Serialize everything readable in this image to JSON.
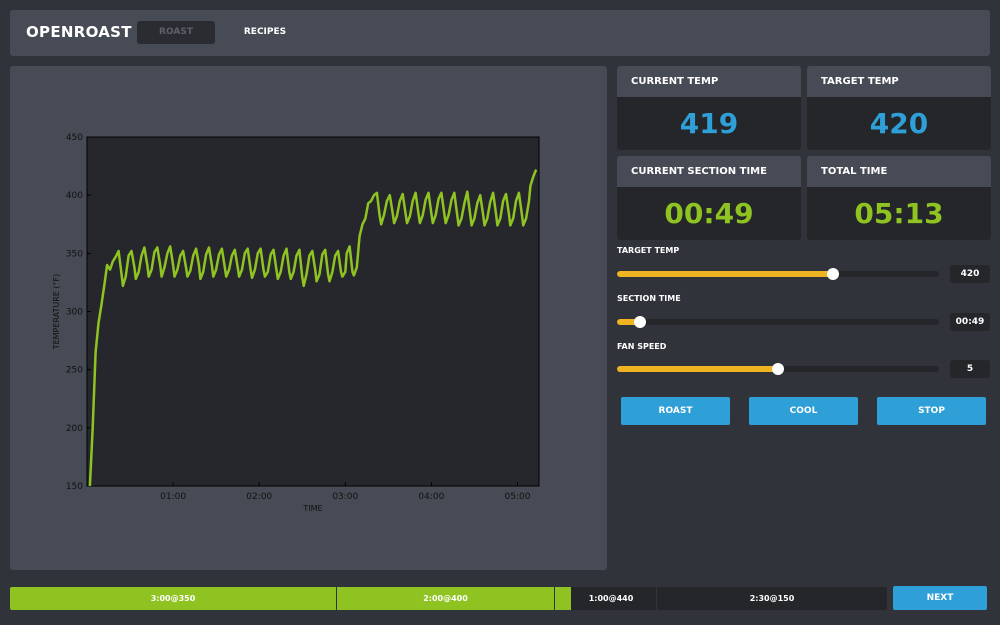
{
  "header": {
    "brand": "OPENROAST",
    "tabs": [
      {
        "label": "ROAST",
        "active": true
      },
      {
        "label": "RECIPES",
        "active": false
      }
    ]
  },
  "stats": {
    "current_temp": {
      "label": "CURRENT TEMP",
      "value": "419"
    },
    "target_temp": {
      "label": "TARGET TEMP",
      "value": "420"
    },
    "current_section_time": {
      "label": "CURRENT SECTION TIME",
      "value": "00:49"
    },
    "total_time": {
      "label": "TOTAL TIME",
      "value": "05:13"
    }
  },
  "controls": {
    "target_temp": {
      "label": "TARGET TEMP",
      "value": "420",
      "level": 0.67
    },
    "section_time": {
      "label": "SECTION TIME",
      "value": "00:49",
      "level": 0.07
    },
    "fan_speed": {
      "label": "FAN SPEED",
      "value": "5",
      "level": 0.5
    }
  },
  "buttons": {
    "roast": "ROAST",
    "cool": "COOL",
    "stop": "STOP",
    "next": "NEXT"
  },
  "timeline": {
    "segments": [
      {
        "label": "3:00@350"
      },
      {
        "label": "2:00@400"
      },
      {
        "label": "1:00@440"
      },
      {
        "label": "2:30@150"
      }
    ],
    "elapsed_fraction": 0.64
  },
  "colors": {
    "accent_blue": "#2f9fd8",
    "accent_green": "#8fc321",
    "slider_orange": "#f0b322",
    "panel": "#474b55",
    "dark": "#24262a"
  },
  "chart_data": {
    "type": "line",
    "xlabel": "TIME",
    "ylabel": "TEMPERATURE (°F)",
    "xlim": [
      0,
      315
    ],
    "ylim": [
      150,
      450
    ],
    "x_ticks": [
      {
        "value": 60,
        "label": "01:00"
      },
      {
        "value": 120,
        "label": "02:00"
      },
      {
        "value": 180,
        "label": "03:00"
      },
      {
        "value": 240,
        "label": "04:00"
      },
      {
        "value": 300,
        "label": "05:00"
      }
    ],
    "y_ticks": [
      150,
      200,
      250,
      300,
      350,
      400,
      450
    ],
    "series": [
      {
        "color": "#8fc321",
        "points": [
          [
            2,
            150
          ],
          [
            4,
            200
          ],
          [
            6,
            265
          ],
          [
            8,
            290
          ],
          [
            10,
            305
          ],
          [
            12,
            322
          ],
          [
            14,
            340
          ],
          [
            16,
            336
          ],
          [
            18,
            343
          ],
          [
            20,
            347
          ],
          [
            22,
            352
          ],
          [
            24,
            333
          ],
          [
            25,
            322
          ],
          [
            27,
            330
          ],
          [
            29,
            348
          ],
          [
            31,
            352
          ],
          [
            33,
            338
          ],
          [
            34,
            328
          ],
          [
            36,
            334
          ],
          [
            38,
            348
          ],
          [
            40,
            355
          ],
          [
            42,
            340
          ],
          [
            43,
            330
          ],
          [
            45,
            336
          ],
          [
            47,
            351
          ],
          [
            49,
            355
          ],
          [
            51,
            340
          ],
          [
            52,
            330
          ],
          [
            54,
            338
          ],
          [
            56,
            350
          ],
          [
            58,
            356
          ],
          [
            60,
            340
          ],
          [
            61,
            330
          ],
          [
            63,
            336
          ],
          [
            65,
            348
          ],
          [
            67,
            352
          ],
          [
            69,
            338
          ],
          [
            70,
            330
          ],
          [
            72,
            335
          ],
          [
            74,
            348
          ],
          [
            76,
            354
          ],
          [
            78,
            340
          ],
          [
            79,
            328
          ],
          [
            81,
            334
          ],
          [
            83,
            349
          ],
          [
            85,
            355
          ],
          [
            87,
            340
          ],
          [
            88,
            330
          ],
          [
            90,
            336
          ],
          [
            92,
            349
          ],
          [
            94,
            354
          ],
          [
            96,
            338
          ],
          [
            97,
            330
          ],
          [
            99,
            336
          ],
          [
            101,
            348
          ],
          [
            103,
            353
          ],
          [
            105,
            338
          ],
          [
            106,
            330
          ],
          [
            108,
            336
          ],
          [
            110,
            350
          ],
          [
            112,
            354
          ],
          [
            114,
            336
          ],
          [
            115,
            329
          ],
          [
            117,
            336
          ],
          [
            119,
            350
          ],
          [
            121,
            354
          ],
          [
            123,
            336
          ],
          [
            124,
            330
          ],
          [
            126,
            334
          ],
          [
            128,
            349
          ],
          [
            130,
            353
          ],
          [
            132,
            336
          ],
          [
            133,
            328
          ],
          [
            135,
            334
          ],
          [
            137,
            348
          ],
          [
            139,
            354
          ],
          [
            141,
            334
          ],
          [
            142,
            328
          ],
          [
            144,
            334
          ],
          [
            146,
            348
          ],
          [
            148,
            353
          ],
          [
            150,
            330
          ],
          [
            151,
            322
          ],
          [
            153,
            332
          ],
          [
            155,
            348
          ],
          [
            157,
            352
          ],
          [
            159,
            336
          ],
          [
            160,
            326
          ],
          [
            162,
            332
          ],
          [
            164,
            349
          ],
          [
            166,
            353
          ],
          [
            168,
            332
          ],
          [
            169,
            326
          ],
          [
            171,
            334
          ],
          [
            173,
            348
          ],
          [
            175,
            352
          ],
          [
            177,
            334
          ],
          [
            178,
            330
          ],
          [
            180,
            334
          ],
          [
            181,
            350
          ],
          [
            183,
            356
          ],
          [
            185,
            334
          ],
          [
            186,
            331
          ],
          [
            188,
            338
          ],
          [
            190,
            365
          ],
          [
            192,
            375
          ],
          [
            194,
            380
          ],
          [
            196,
            393
          ],
          [
            198,
            395
          ],
          [
            200,
            400
          ],
          [
            202,
            402
          ],
          [
            204,
            382
          ],
          [
            205,
            375
          ],
          [
            207,
            383
          ],
          [
            209,
            395
          ],
          [
            211,
            400
          ],
          [
            213,
            385
          ],
          [
            214,
            376
          ],
          [
            216,
            382
          ],
          [
            218,
            395
          ],
          [
            220,
            401
          ],
          [
            222,
            384
          ],
          [
            223,
            376
          ],
          [
            225,
            382
          ],
          [
            227,
            395
          ],
          [
            229,
            402
          ],
          [
            231,
            384
          ],
          [
            232,
            376
          ],
          [
            234,
            383
          ],
          [
            236,
            396
          ],
          [
            238,
            402
          ],
          [
            240,
            384
          ],
          [
            241,
            376
          ],
          [
            243,
            383
          ],
          [
            245,
            397
          ],
          [
            247,
            402
          ],
          [
            249,
            384
          ],
          [
            250,
            376
          ],
          [
            252,
            383
          ],
          [
            254,
            396
          ],
          [
            256,
            402
          ],
          [
            258,
            383
          ],
          [
            259,
            374
          ],
          [
            261,
            380
          ],
          [
            263,
            393
          ],
          [
            265,
            403
          ],
          [
            267,
            384
          ],
          [
            268,
            374
          ],
          [
            270,
            380
          ],
          [
            272,
            393
          ],
          [
            274,
            400
          ],
          [
            276,
            384
          ],
          [
            277,
            374
          ],
          [
            279,
            380
          ],
          [
            281,
            394
          ],
          [
            283,
            402
          ],
          [
            285,
            384
          ],
          [
            286,
            374
          ],
          [
            288,
            380
          ],
          [
            290,
            395
          ],
          [
            292,
            401
          ],
          [
            294,
            384
          ],
          [
            295,
            374
          ],
          [
            297,
            380
          ],
          [
            299,
            395
          ],
          [
            301,
            402
          ],
          [
            303,
            384
          ],
          [
            304,
            374
          ],
          [
            306,
            380
          ],
          [
            308,
            395
          ],
          [
            309,
            408
          ],
          [
            311,
            416
          ],
          [
            313,
            422
          ]
        ]
      }
    ]
  }
}
